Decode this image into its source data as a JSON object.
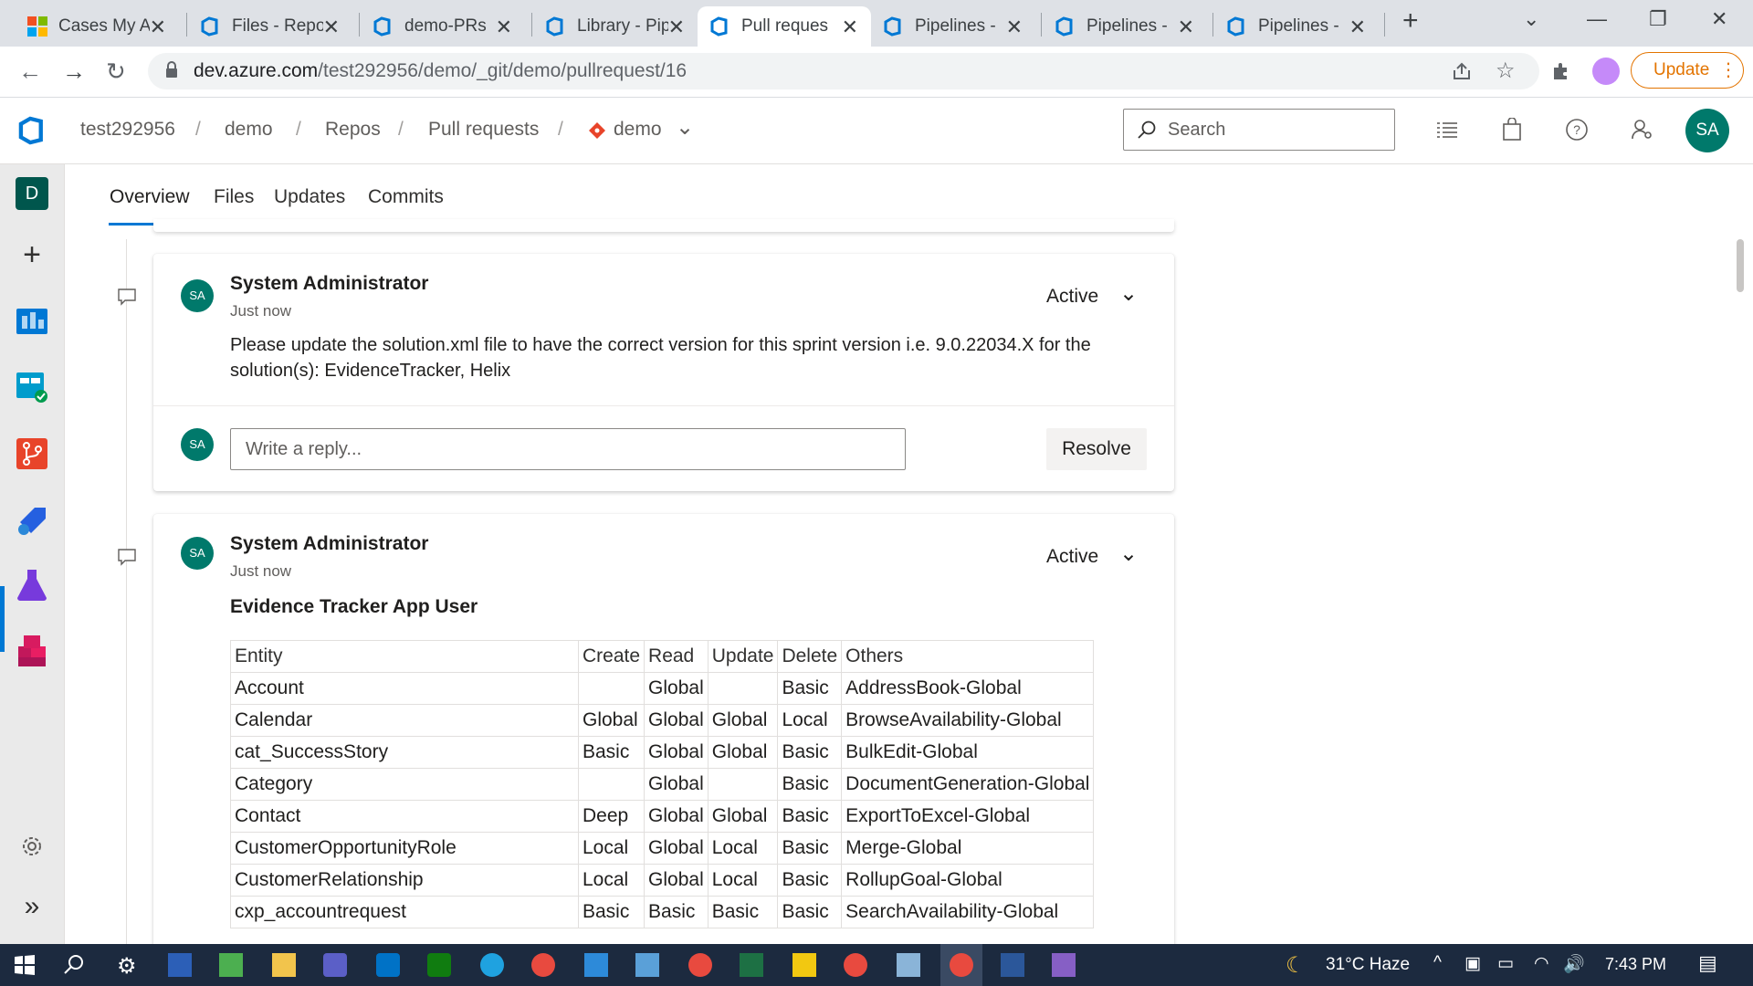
{
  "browser": {
    "tabs": [
      {
        "label": "Cases My A",
        "icon": "microsoft-logo-icon"
      },
      {
        "label": "Files - Repo",
        "icon": "azure-devops-icon"
      },
      {
        "label": "demo-PRs",
        "icon": "azure-devops-icon"
      },
      {
        "label": "Library - Pip",
        "icon": "azure-devops-icon"
      },
      {
        "label": "Pull reques",
        "icon": "azure-devops-icon",
        "active": true
      },
      {
        "label": "Pipelines -",
        "icon": "azure-devops-icon"
      },
      {
        "label": "Pipelines -",
        "icon": "azure-devops-icon"
      },
      {
        "label": "Pipelines -",
        "icon": "azure-devops-icon"
      }
    ],
    "url_host": "dev.azure.com",
    "url_path": "/test292956/demo/_git/demo/pullrequest/16",
    "update_label": "Update"
  },
  "header": {
    "breadcrumb": [
      "test292956",
      "demo",
      "Repos",
      "Pull requests",
      "demo"
    ],
    "search_placeholder": "Search",
    "avatar_initials": "SA"
  },
  "rail": {
    "project_initial": "D"
  },
  "subtabs": [
    "Overview",
    "Files",
    "Updates",
    "Commits"
  ],
  "threads": [
    {
      "avatar": "SA",
      "author": "System Administrator",
      "time": "Just now",
      "status": "Active",
      "text": "Please update the solution.xml file to have the correct version for this sprint version i.e. 9.0.22034.X for the solution(s): EvidenceTracker, Helix",
      "reply_placeholder": "Write a reply...",
      "resolve_label": "Resolve"
    },
    {
      "avatar": "SA",
      "author": "System Administrator",
      "time": "Just now",
      "status": "Active",
      "heading": "Evidence Tracker App User",
      "table": {
        "columns": [
          "Entity",
          "Create",
          "Read",
          "Update",
          "Delete",
          "Others"
        ],
        "rows": [
          [
            "Account",
            "",
            "Global",
            "",
            "Basic",
            "AddressBook-Global"
          ],
          [
            "Calendar",
            "Global",
            "Global",
            "Global",
            "Local",
            "BrowseAvailability-Global"
          ],
          [
            "cat_SuccessStory",
            "Basic",
            "Global",
            "Global",
            "Basic",
            "BulkEdit-Global"
          ],
          [
            "Category",
            "",
            "Global",
            "",
            "Basic",
            "DocumentGeneration-Global"
          ],
          [
            "Contact",
            "Deep",
            "Global",
            "Global",
            "Basic",
            "ExportToExcel-Global"
          ],
          [
            "CustomerOpportunityRole",
            "Local",
            "Global",
            "Local",
            "Basic",
            "Merge-Global"
          ],
          [
            "CustomerRelationship",
            "Local",
            "Global",
            "Local",
            "Basic",
            "RollupGoal-Global"
          ],
          [
            "cxp_accountrequest",
            "Basic",
            "Basic",
            "Basic",
            "Basic",
            "SearchAvailability-Global"
          ]
        ]
      }
    }
  ],
  "taskbar": {
    "weather": "31°C  Haze",
    "time": "7:43 PM"
  }
}
